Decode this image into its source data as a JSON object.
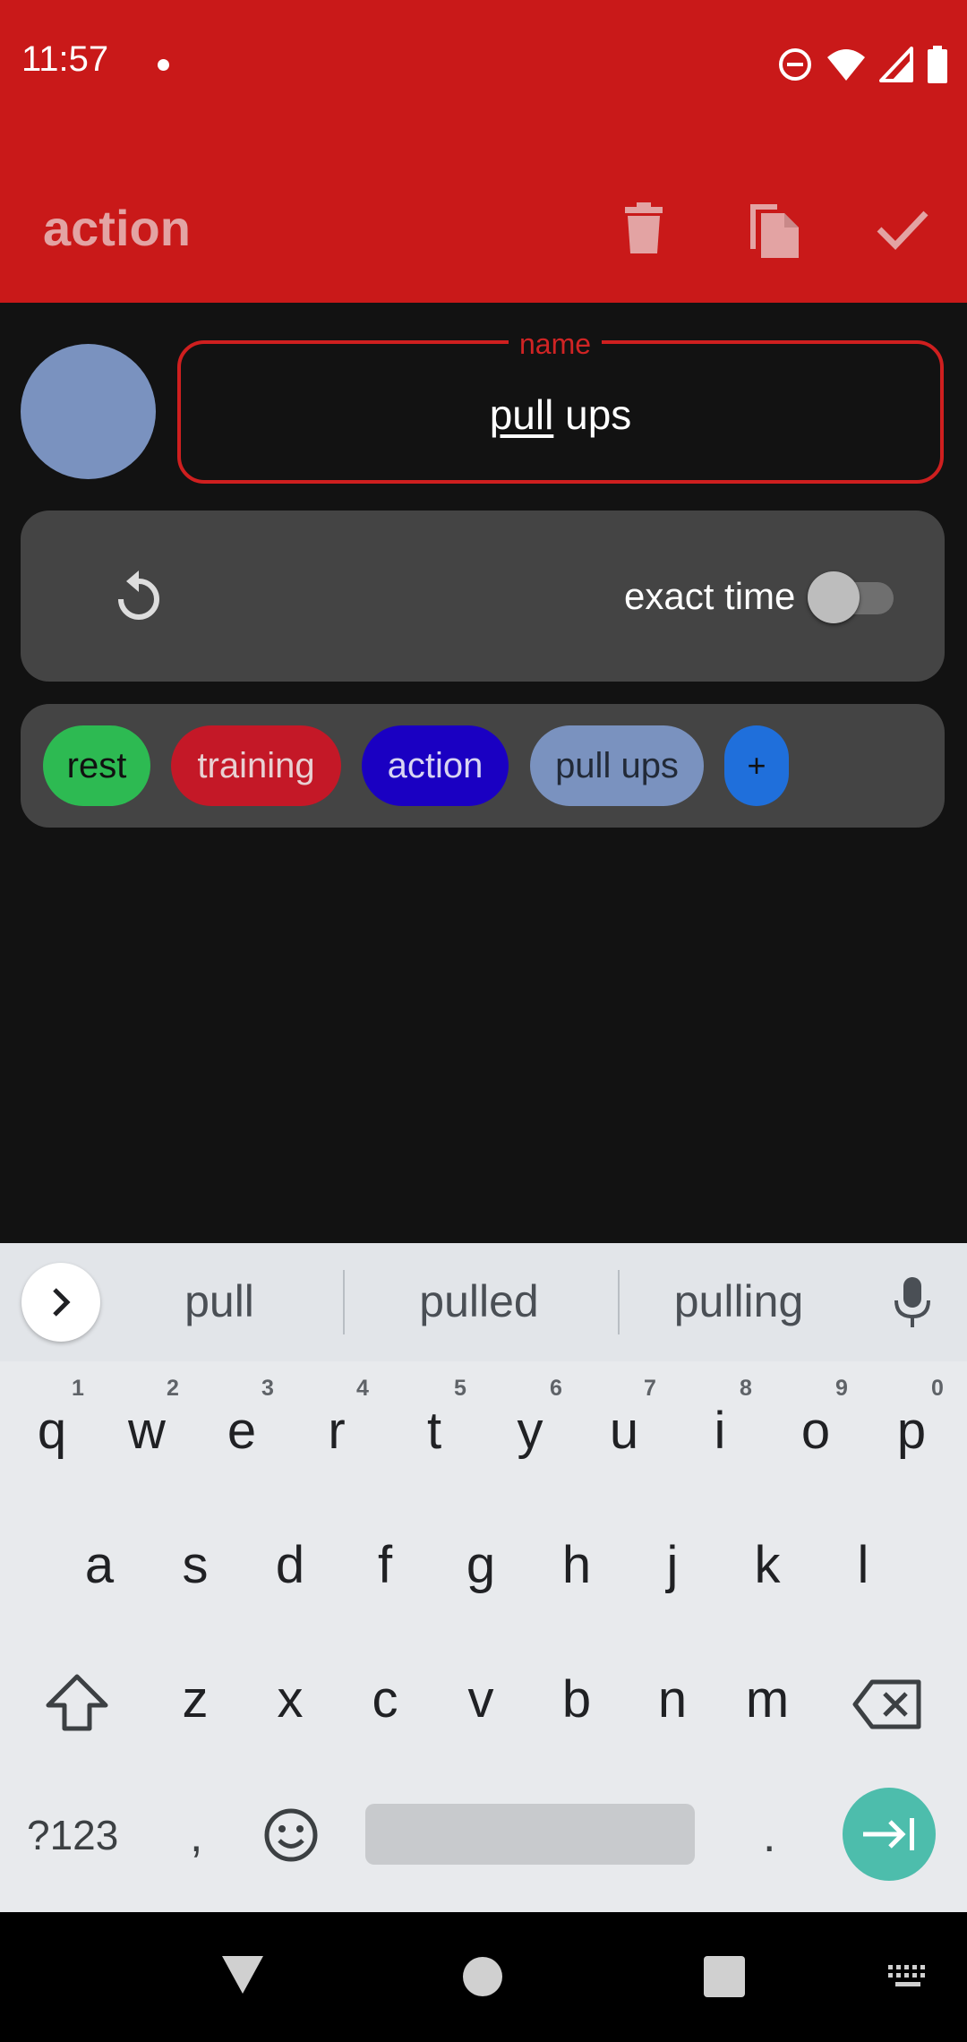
{
  "status_bar": {
    "time": "11:57"
  },
  "toolbar": {
    "title": "action"
  },
  "form": {
    "name_legend": "name",
    "name_value_underlined": "pull",
    "name_value_rest": " ups",
    "exact_time_label": "exact time",
    "exact_time_on": false,
    "avatar_color": "#7a92bf"
  },
  "tags": [
    {
      "label": "rest",
      "bg": "#2dba52",
      "fg": "#111111"
    },
    {
      "label": "training",
      "bg": "#c41827",
      "fg": "#e8d0d2"
    },
    {
      "label": "action",
      "bg": "#1a00c2",
      "fg": "#d8d4f2"
    },
    {
      "label": "pull ups",
      "bg": "#7a92bf",
      "fg": "#222a38"
    },
    {
      "label": "+",
      "bg": "#1f6fdb",
      "fg": "#111111"
    }
  ],
  "keyboard": {
    "suggestions": [
      "pull",
      "pulled",
      "pulling"
    ],
    "row1": [
      "q",
      "w",
      "e",
      "r",
      "t",
      "y",
      "u",
      "i",
      "o",
      "p"
    ],
    "row1_hints": [
      "1",
      "2",
      "3",
      "4",
      "5",
      "6",
      "7",
      "8",
      "9",
      "0"
    ],
    "row2": [
      "a",
      "s",
      "d",
      "f",
      "g",
      "h",
      "j",
      "k",
      "l"
    ],
    "row3": [
      "z",
      "x",
      "c",
      "v",
      "b",
      "n",
      "m"
    ],
    "symbols_label": "?123",
    "comma": ",",
    "period": "."
  }
}
